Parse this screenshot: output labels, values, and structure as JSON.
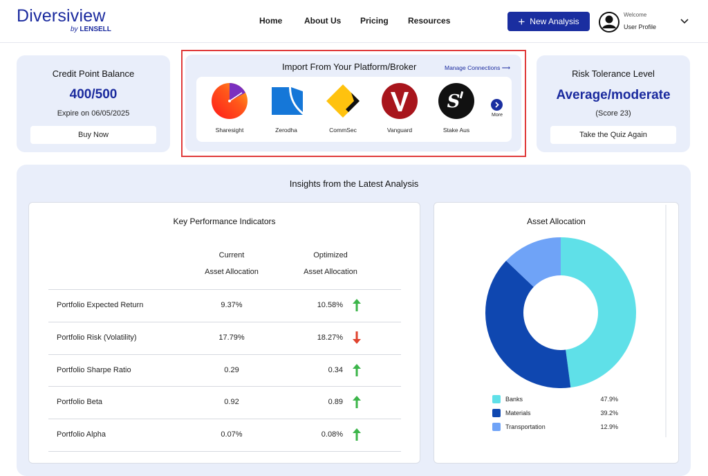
{
  "brand": {
    "name": "Diversiview",
    "by": "by",
    "company": "LENSELL",
    "color": "#1a2a9e"
  },
  "nav": [
    {
      "label": "Home"
    },
    {
      "label": "About Us"
    },
    {
      "label": "Pricing"
    },
    {
      "label": "Resources"
    }
  ],
  "header": {
    "new_analysis": "New Analysis",
    "welcome": "Welcome",
    "profile": "User Profile"
  },
  "credit": {
    "title": "Credit Point Balance",
    "value": "400/500",
    "expiry": "Expire on 06/05/2025",
    "button": "Buy Now"
  },
  "import": {
    "title": "Import From Your Platform/Broker",
    "manage": "Manage Connections ⟶",
    "brokers": [
      {
        "name": "Sharesight",
        "icon": "sharesight-logo"
      },
      {
        "name": "Zerodha",
        "icon": "zerodha-logo"
      },
      {
        "name": "CommSec",
        "icon": "commsec-logo"
      },
      {
        "name": "Vanguard",
        "icon": "vanguard-logo"
      },
      {
        "name": "Stake Aus",
        "icon": "stake-logo"
      }
    ],
    "more": "More"
  },
  "risk": {
    "title": "Risk Tolerance Level",
    "value": "Average/moderate",
    "score": "(Score 23)",
    "button": "Take the Quiz Again"
  },
  "insights": {
    "title": "Insights from the Latest Analysis",
    "kpi": {
      "title": "Key Performance Indicators",
      "col_current": [
        "Current",
        "Asset Allocation"
      ],
      "col_optimized": [
        "Optimized",
        "Asset Allocation"
      ],
      "rows": [
        {
          "label": "Portfolio Expected Return",
          "current": "9.37%",
          "optimized": "10.58%",
          "trend": "up"
        },
        {
          "label": "Portfolio Risk (Volatility)",
          "current": "17.79%",
          "optimized": "18.27%",
          "trend": "down"
        },
        {
          "label": "Portfolio Sharpe Ratio",
          "current": "0.29",
          "optimized": "0.34",
          "trend": "up"
        },
        {
          "label": "Portfolio Beta",
          "current": "0.92",
          "optimized": "0.89",
          "trend": "up"
        },
        {
          "label": "Portfolio Alpha",
          "current": "0.07%",
          "optimized": "0.08%",
          "trend": "up"
        }
      ],
      "colors": {
        "up": "#3cb54a",
        "down": "#e0432f"
      }
    }
  },
  "chart_data": {
    "type": "pie",
    "title": "Asset Allocation",
    "categories": [
      "Banks",
      "Materials",
      "Transportation"
    ],
    "values": [
      47.9,
      39.2,
      12.9
    ],
    "labels": [
      "47.9%",
      "39.2%",
      "12.9%"
    ],
    "colors": [
      "#5fe0e8",
      "#0f47b0",
      "#6fa3f7"
    ],
    "donut": true,
    "legend": "bottom"
  }
}
